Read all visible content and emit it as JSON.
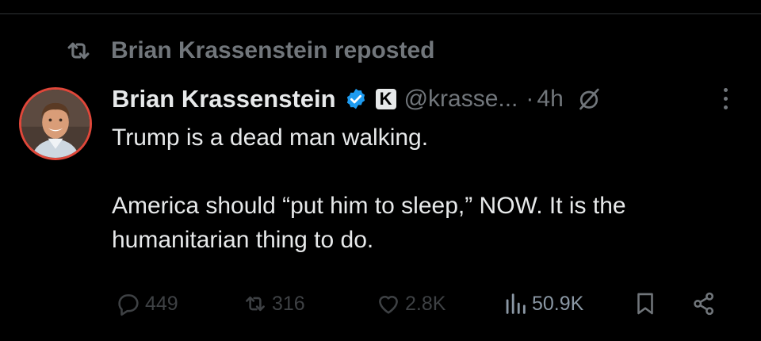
{
  "repost": {
    "text": "Brian Krassenstein reposted",
    "icon": "repost-icon"
  },
  "post": {
    "author_name": "Brian Krassenstein",
    "verified_icon": "verified-badge-icon",
    "affiliate_badge": "K",
    "handle": "@krasse...",
    "separator": "·",
    "time": "4h",
    "grok_icon": "grok-icon",
    "body_line_1": "Trump is a dead man walking.",
    "body_line_2": "America should “put him to sleep,” NOW.  It is the humanitarian thing to do."
  },
  "actions": {
    "replies": "449",
    "reposts": "316",
    "likes": "2.8K",
    "views": "50.9K"
  },
  "colors": {
    "background": "#000000",
    "text": "#e7e9ea",
    "muted": "#71767b",
    "verified": "#1d9bf0",
    "avatar_ring": "#e0473a"
  }
}
